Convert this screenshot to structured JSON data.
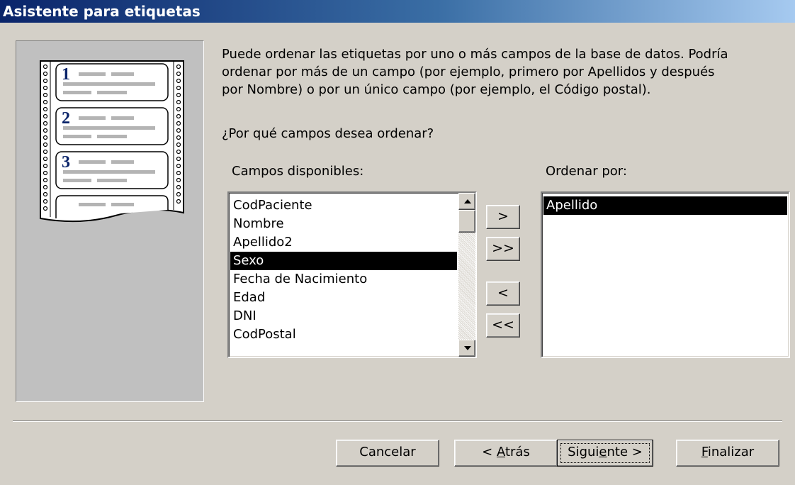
{
  "window": {
    "title": "Asistente para etiquetas"
  },
  "illustration": {
    "labels": [
      "1",
      "2",
      "3"
    ]
  },
  "description": {
    "line1": "Puede ordenar las etiquetas por uno o más campos de la base de datos. Podría",
    "line2": "ordenar por más de un campo (por ejemplo, primero por Apellidos y después",
    "line3": "por Nombre) o por un único campo (por ejemplo, el Código postal)."
  },
  "question": "¿Por qué campos desea ordenar?",
  "available": {
    "label": "Campos disponibles:",
    "items": [
      "CodPaciente",
      "Nombre",
      "Apellido2",
      "Sexo",
      "Fecha de Nacimiento",
      "Edad",
      "DNI",
      "CodPostal"
    ],
    "selected": "Sexo"
  },
  "sorted": {
    "label": "Ordenar por:",
    "items": [
      "Apellido"
    ],
    "selected": "Apellido"
  },
  "transfer_buttons": {
    "add_one": ">",
    "add_all": ">>",
    "remove_one": "<",
    "remove_all": "<<"
  },
  "footer": {
    "cancel": "Cancelar",
    "back_prefix": "< ",
    "back_mnemonic": "A",
    "back_rest": "trás",
    "next_pre": "Sigui",
    "next_mnemonic": "e",
    "next_post": "nte >",
    "finish_mnemonic": "F",
    "finish_rest": "inalizar"
  },
  "colors": {
    "titlebar_start": "#0a246a",
    "titlebar_end": "#a6caf0",
    "selection": "#000000",
    "label_number": "#0a246a"
  }
}
